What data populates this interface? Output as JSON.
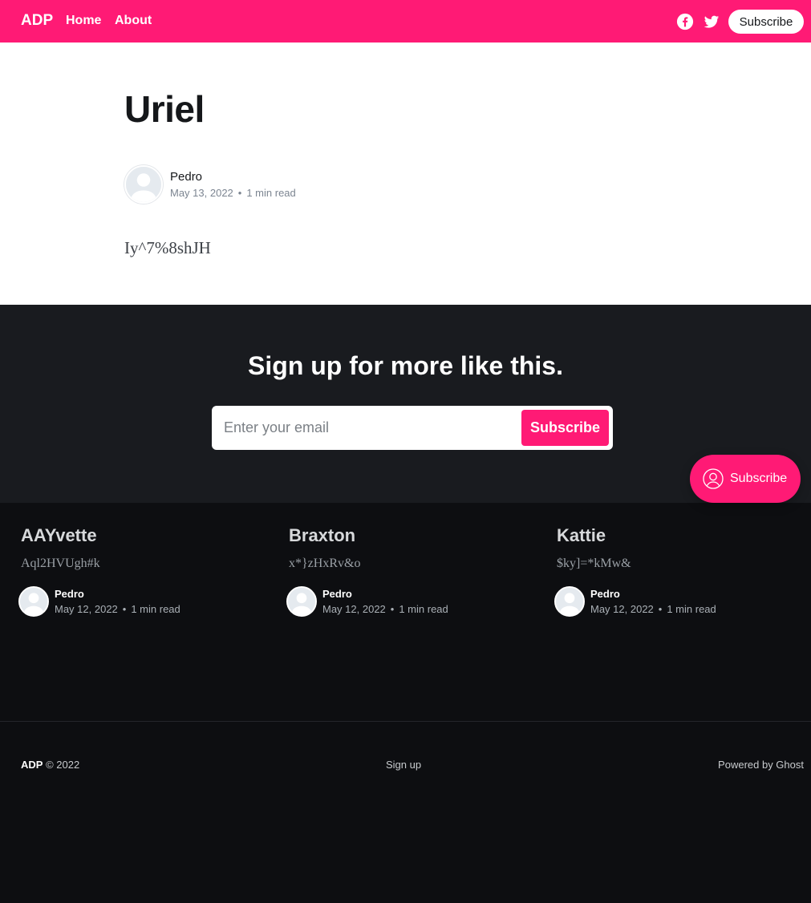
{
  "header": {
    "brand": "ADP",
    "nav": [
      "Home",
      "About"
    ],
    "social_icons": [
      "facebook-icon",
      "twitter-icon"
    ],
    "subscribe_label": "Subscribe",
    "accent_color": "#ff1a75"
  },
  "article": {
    "title": "Uriel",
    "author": "Pedro",
    "date": "May 13, 2022",
    "read_time": "1 min read",
    "content": "Iy^7%8shJH"
  },
  "signup": {
    "heading": "Sign up for more like this.",
    "email_placeholder": "Enter your email",
    "button_label": "Subscribe",
    "floating_label": "Subscribe"
  },
  "related": [
    {
      "title": "AAYvette",
      "excerpt": "Aql2HVUgh#k",
      "author": "Pedro",
      "date": "May 12, 2022",
      "read_time": "1 min read"
    },
    {
      "title": "Braxton",
      "excerpt": "x*}zHxRv&o",
      "author": "Pedro",
      "date": "May 12, 2022",
      "read_time": "1 min read"
    },
    {
      "title": "Kattie",
      "excerpt": "$ky]=*kMw&",
      "author": "Pedro",
      "date": "May 12, 2022",
      "read_time": "1 min read"
    }
  ],
  "footer": {
    "brand": "ADP",
    "copyright": "© 2022",
    "signup_link": "Sign up",
    "powered_by": "Powered by Ghost"
  }
}
